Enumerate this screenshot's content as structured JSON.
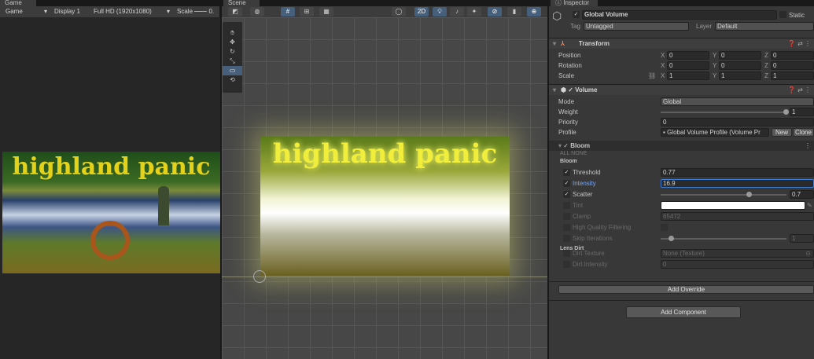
{
  "game": {
    "tab": "Game",
    "mode": "Game",
    "display": "Display 1",
    "resolution": "Full HD (1920x1080)",
    "scale_label": "Scale",
    "scale_value": "0.",
    "title_art": "highland panic"
  },
  "scene": {
    "tab": "Scene",
    "btn_2d": "2D",
    "title_art": "highland panic"
  },
  "inspector": {
    "tab": "Inspector",
    "object_name": "Global Volume",
    "static_label": "Static",
    "tag_label": "Tag",
    "tag_value": "Untagged",
    "layer_label": "Layer",
    "layer_value": "Default",
    "transform": {
      "title": "Transform",
      "rows": [
        {
          "label": "Position",
          "x": "0",
          "y": "0",
          "z": "0"
        },
        {
          "label": "Rotation",
          "x": "0",
          "y": "0",
          "z": "0"
        },
        {
          "label": "Scale",
          "x": "1",
          "y": "1",
          "z": "1"
        }
      ]
    },
    "volume": {
      "title": "Volume",
      "mode_label": "Mode",
      "mode_value": "Global",
      "weight_label": "Weight",
      "weight_value": "1",
      "priority_label": "Priority",
      "priority_value": "0",
      "profile_label": "Profile",
      "profile_value": "Global Volume Profile (Volume Pr",
      "new_label": "New",
      "clone_label": "Clone"
    },
    "bloom": {
      "title": "Bloom",
      "all": "ALL",
      "none": "NONE",
      "section": "Bloom",
      "threshold_label": "Threshold",
      "threshold_value": "0.77",
      "intensity_label": "Intensity",
      "intensity_value": "16.9",
      "scatter_label": "Scatter",
      "scatter_value": "0.7",
      "scatter_fraction": 0.7,
      "tint_label": "Tint",
      "tint_color": "#ffffff",
      "clamp_label": "Clamp",
      "clamp_value": "65472",
      "hq_label": "High Quality Filtering",
      "skip_label": "Skip Iterations",
      "skip_value": "1",
      "lens_section": "Lens Dirt",
      "dirt_tex_label": "Dirt Texture",
      "dirt_tex_value": "None (Texture)",
      "dirt_int_label": "Dirt Intensity",
      "dirt_int_value": "0"
    },
    "add_override": "Add Override",
    "add_component": "Add Component"
  }
}
